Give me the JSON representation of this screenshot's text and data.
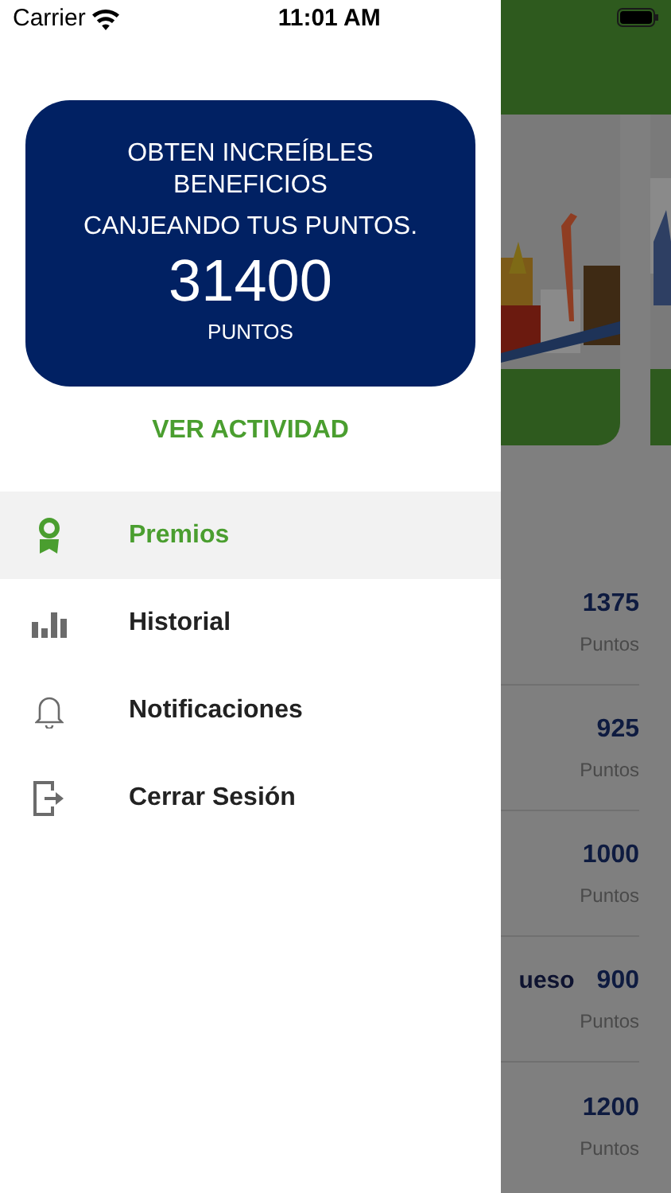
{
  "status_bar": {
    "carrier": "Carrier",
    "time": "11:01 AM"
  },
  "points_card": {
    "headline": "OBTEN INCREÍBLES BENEFICIOS",
    "subline": "CANJEANDO TUS PUNTOS.",
    "points": "31400",
    "unit": "PUNTOS"
  },
  "activity_link": "VER ACTIVIDAD",
  "menu": [
    {
      "kind": "award",
      "label": "Premios",
      "selected": true
    },
    {
      "kind": "chart",
      "label": "Historial",
      "selected": false
    },
    {
      "kind": "bell",
      "label": "Notificaciones",
      "selected": false
    },
    {
      "kind": "logout",
      "label": "Cerrar Sesión",
      "selected": false
    }
  ],
  "background": {
    "rewards": [
      {
        "points": "1375",
        "unit": "Puntos"
      },
      {
        "points": "925",
        "unit": "Puntos"
      },
      {
        "points": "1000",
        "unit": "Puntos"
      },
      {
        "title": "ueso",
        "points": "900",
        "unit": "Puntos"
      },
      {
        "points": "1200",
        "unit": "Puntos"
      }
    ]
  }
}
